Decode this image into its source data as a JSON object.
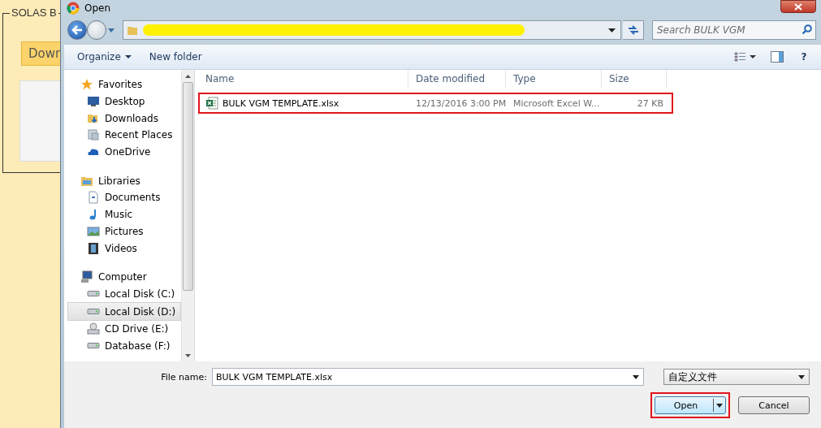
{
  "background_page": {
    "section_title": "SOLAS B",
    "button": "Down"
  },
  "dialog": {
    "title": "Open",
    "search": {
      "placeholder": "Search BULK VGM"
    },
    "toolbar": [
      "Organize",
      "New folder"
    ],
    "help_symbol": "?",
    "nav": [
      {
        "label": "Favorites",
        "kind": "star",
        "selected": false,
        "children": [
          {
            "label": "Desktop",
            "kind": "desktop",
            "selected": false
          },
          {
            "label": "Downloads",
            "kind": "downloads",
            "selected": false
          },
          {
            "label": "Recent Places",
            "kind": "recent",
            "selected": false
          },
          {
            "label": "OneDrive",
            "kind": "cloud",
            "selected": false
          }
        ]
      },
      {
        "label": "Libraries",
        "kind": "library",
        "selected": false,
        "children": [
          {
            "label": "Documents",
            "kind": "document",
            "selected": false
          },
          {
            "label": "Music",
            "kind": "music",
            "selected": false
          },
          {
            "label": "Pictures",
            "kind": "picture",
            "selected": false
          },
          {
            "label": "Videos",
            "kind": "video",
            "selected": false
          }
        ]
      },
      {
        "label": "Computer",
        "kind": "computer",
        "selected": false,
        "children": [
          {
            "label": "Local Disk (C:)",
            "kind": "disk",
            "selected": false
          },
          {
            "label": "Local Disk (D:)",
            "kind": "disk",
            "selected": true
          },
          {
            "label": "CD Drive (E:)",
            "kind": "cd",
            "selected": false
          },
          {
            "label": "Database (F:)",
            "kind": "disk",
            "selected": false
          }
        ]
      }
    ],
    "columns": [
      "Name",
      "Date modified",
      "Type",
      "Size"
    ],
    "files": [
      {
        "name": "BULK VGM TEMPLATE.xlsx",
        "date": "12/13/2016 3:00 PM",
        "type": "Microsoft Excel W...",
        "size": "27 KB",
        "marked": true
      }
    ],
    "file_name_label": "File name:",
    "file_name": "BULK VGM TEMPLATE.xlsx",
    "file_type": "自定义文件",
    "open_button": {
      "label": "Open",
      "marked": true
    },
    "cancel_button": "Cancel"
  }
}
